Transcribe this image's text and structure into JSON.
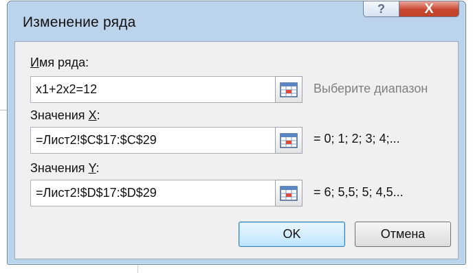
{
  "dialog": {
    "title": "Изменение ряда",
    "help_glyph": "?",
    "close_glyph": "X"
  },
  "series_name": {
    "label_first": "И",
    "label_rest": "мя ряда:",
    "value": "x1+2x2=12",
    "hint": "Выберите диапазон"
  },
  "x_values": {
    "label_prefix": "Значения ",
    "label_key": "X",
    "label_suffix": ":",
    "value": "=Лист2!$C$17:$C$29",
    "preview": "= 0; 1; 2; 3; 4;..."
  },
  "y_values": {
    "label_prefix": "Значения ",
    "label_key": "Y",
    "label_suffix": ":",
    "value": "=Лист2!$D$17:$D$29",
    "preview": "= 6; 5,5; 5; 4,5..."
  },
  "buttons": {
    "ok": "OK",
    "cancel": "Отмена"
  },
  "icons": {
    "help": "help-icon",
    "close": "close-icon",
    "range_select": "range-select-icon"
  },
  "colors": {
    "frame": "#bcd3ec",
    "close_red": "#c8462f",
    "ok_blue": "#bee6fd"
  }
}
